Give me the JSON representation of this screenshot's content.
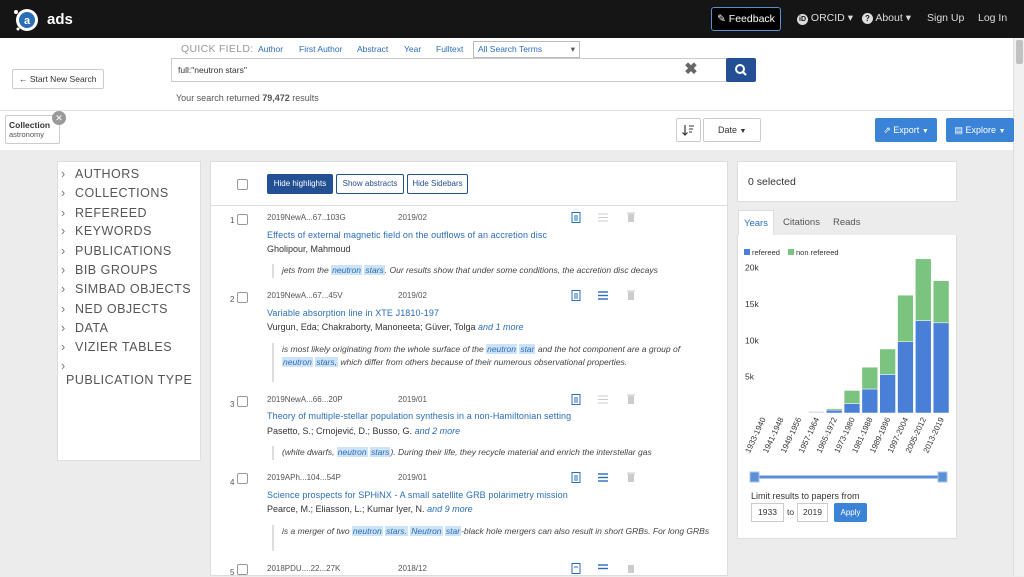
{
  "header": {
    "logo_text": "ads",
    "feedback": "Feedback",
    "orcid": "ORCID",
    "about": "About",
    "sign_up": "Sign Up",
    "log_in": "Log In"
  },
  "search": {
    "start_new": "Start New Search",
    "quick_field_label": "QUICK FIELD:",
    "quick_fields": [
      "Author",
      "First Author",
      "Abstract",
      "Year",
      "Fulltext"
    ],
    "all_terms": "All Search Terms",
    "query": "full:\"neutron stars\"",
    "results_prefix": "Your search returned",
    "results_count": "79,472",
    "results_suffix": "results"
  },
  "filters": {
    "collection_title": "Collection",
    "collection_value": "astronomy",
    "sort_label": "Date",
    "export_label": "Export",
    "explore_label": "Explore"
  },
  "sidebar": {
    "items": [
      "AUTHORS",
      "COLLECTIONS",
      "REFEREED",
      "KEYWORDS",
      "PUBLICATIONS",
      "BIB GROUPS",
      "SIMBAD OBJECTS",
      "NED OBJECTS",
      "DATA",
      "VIZIER TABLES",
      "PUBLICATION TYPE"
    ]
  },
  "toolbar": {
    "hide_highlights": "Hide highlights",
    "show_abstracts": "Show abstracts",
    "hide_sidebars": "Hide Sidebars"
  },
  "results": [
    {
      "num": "1",
      "bibcode": "2019NewA...67..103G",
      "date": "2019/02",
      "title": "Effects of external magnetic field on the outflows of an accretion disc",
      "authors": "Gholipour, Mahmoud",
      "more": ""
    },
    {
      "num": "2",
      "bibcode": "2019NewA...67...45V",
      "date": "2019/02",
      "title": "Variable absorption line in XTE J1810-197",
      "authors": "Vurgun, Eda;  Chakraborty, Manoneeta;  Güver, Tolga",
      "more": "and 1 more"
    },
    {
      "num": "3",
      "bibcode": "2019NewA...66...20P",
      "date": "2019/01",
      "title": "Theory of multiple-stellar population synthesis in a non-Hamiltonian setting",
      "authors": "Pasetto, S.;  Crnojević, D.;  Busso, G.",
      "more": "and 2 more"
    },
    {
      "num": "4",
      "bibcode": "2019APh...104...54P",
      "date": "2019/01",
      "title": "Science prospects for SPHiNX - A small satellite GRB polarimetry mission",
      "authors": "Pearce, M.;  Eliasson, L.;  Kumar Iyer, N.",
      "more": "and 9 more"
    },
    {
      "num": "5",
      "bibcode": "2018PDU....22...27K",
      "date": "2018/12",
      "title": "",
      "authors": "",
      "more": ""
    }
  ],
  "abstracts": {
    "r1": {
      "a": "jets from the ",
      "h1": "neutron",
      "b": " ",
      "h2": "stars",
      "c": ". Our results show that under some conditions, the accretion disc decays"
    },
    "r2": {
      "a": "is most likely originating from the whole surface of the ",
      "h1": "neutron",
      "b": " ",
      "h2": "star",
      "c": " and the hot component are a group of ",
      "h3": "neutron",
      "d": " ",
      "h4": "stars,",
      "e": " which differ from others because of their numerous observational properties."
    },
    "r3": {
      "a": "(white dwarfs, ",
      "h1": "neutron",
      "b": " ",
      "h2": "stars",
      "c": "). During their life, they recycle material and enrich the interstellar gas"
    },
    "r4": {
      "a": "is a merger of two ",
      "h1": "neutron",
      "b": " ",
      "h2": "stars.",
      "c": " ",
      "h3": "Neutron",
      "d": " ",
      "h4": "star",
      "e": "-black hole mergers can also result in short GRBs. For long GRBs"
    }
  },
  "right_panel": {
    "selected": "0 selected",
    "tabs": [
      "Years",
      "Citations",
      "Reads"
    ],
    "limit_label": "Limit results to papers from",
    "year_from": "1933",
    "to": "to",
    "year_to": "2019",
    "apply": "Apply"
  },
  "chart_data": {
    "type": "bar",
    "stacked": true,
    "categories": [
      "1933-1940",
      "1941-1948",
      "1949-1956",
      "1957-1964",
      "1965-1972",
      "1973-1980",
      "1981-1988",
      "1989-1996",
      "1997-2004",
      "2005-2012",
      "2013-2019"
    ],
    "series": [
      {
        "name": "refereed",
        "color": "#4a7fd8",
        "values": [
          0,
          0,
          30,
          100,
          400,
          1300,
          3300,
          5300,
          9800,
          12700,
          12400
        ]
      },
      {
        "name": "non refereed",
        "color": "#7bc47f",
        "values": [
          0,
          0,
          20,
          100,
          200,
          1800,
          3000,
          3500,
          6400,
          8500,
          5800
        ]
      }
    ],
    "ylim": [
      0,
      22000
    ],
    "yticks": [
      "5k",
      "10k",
      "15k",
      "20k"
    ],
    "legend": "top-left"
  }
}
